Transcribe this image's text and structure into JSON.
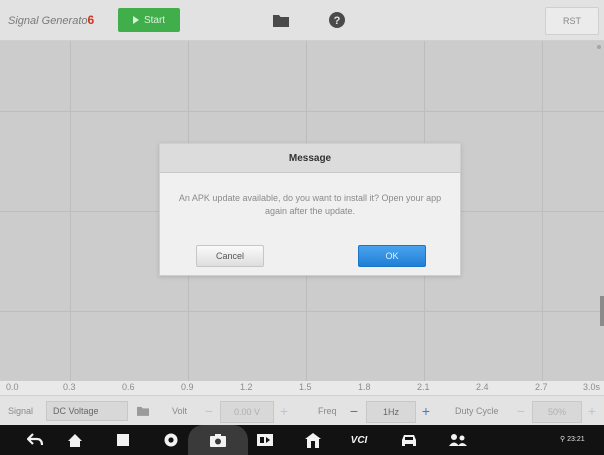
{
  "toolbar": {
    "title_main": "Signal Generato",
    "title_suffix": "6",
    "start_label": "Start",
    "rst_label": "RST"
  },
  "graph": {
    "x_ticks": [
      "0.0",
      "0.3",
      "0.6",
      "0.9",
      "1.2",
      "1.5",
      "1.8",
      "2.1",
      "2.4",
      "2.7",
      "3.0s"
    ]
  },
  "controls": {
    "signal_label": "Signal",
    "signal_value": "DC Voltage",
    "volt_label": "Volt",
    "volt_value": "0.00 V",
    "freq_label": "Freq",
    "freq_value": "1Hz",
    "duty_label": "Duty Cycle",
    "duty_value": "50%"
  },
  "dialog": {
    "title": "Message",
    "message": "An APK update available, do you want to install it? Open your app again after the update.",
    "cancel_label": "Cancel",
    "ok_label": "OK"
  },
  "navbar": {
    "vci_label": "VCI",
    "status_text": "23:21"
  },
  "colors": {
    "start_green": "#3fae4b",
    "ok_blue": "#1f7fd6",
    "title_red": "#d0331f"
  }
}
